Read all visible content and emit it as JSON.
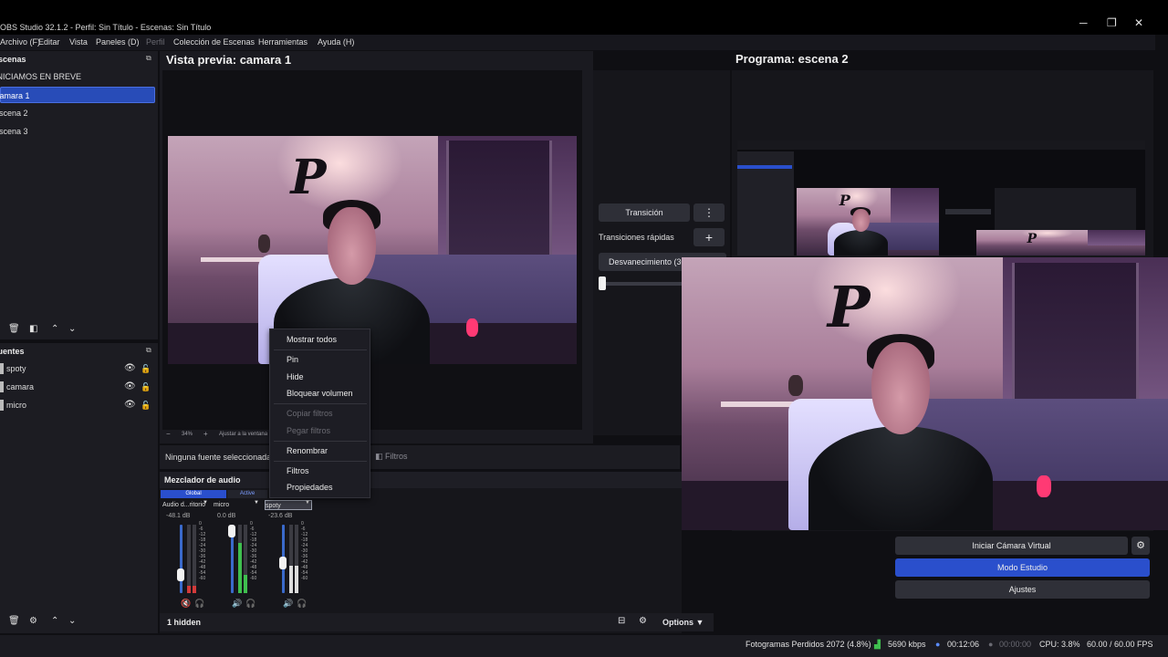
{
  "window": {
    "title": "OBS Studio 32.1.2 - Perfil: Sin Título - Escenas: Sin Título",
    "minimize": "─",
    "restore": "❐",
    "close": "✕"
  },
  "menu": {
    "items": [
      "Archivo (F)",
      "Editar",
      "Vista",
      "Paneles (D)",
      "Perfil",
      "Colección de Escenas",
      "Herramientas",
      "Ayuda (H)"
    ]
  },
  "scenes": {
    "title": "Escenas",
    "items": [
      "INICIAMOS EN BREVE",
      "camara 1",
      "escena 2",
      "escena 3"
    ],
    "selected": "camara 1"
  },
  "sources": {
    "title": "Fuentes",
    "items": [
      {
        "label": "spoty"
      },
      {
        "label": "camara"
      },
      {
        "label": "micro"
      }
    ]
  },
  "preview": {
    "title": "Vista previa: camara 1",
    "zoom": "34%",
    "zoom_minus": "−",
    "zoom_plus": "+",
    "fit": "Ajustar a la ventana"
  },
  "program": {
    "title": "Programa: escena 2"
  },
  "transitions": {
    "transition_button": "Transición",
    "quick_label": "Transiciones rápidas",
    "fade_label": "Desvanecimiento (30"
  },
  "source_bar": {
    "no_source": "Ninguna fuente seleccionada",
    "filters": "Filtros"
  },
  "mixer": {
    "title": "Mezclador de audio",
    "tab_global": "Global",
    "tab_active": "Active",
    "channels": [
      {
        "name": "Audio d...ritorio",
        "db": "-48.1 dB",
        "level": 0.2,
        "muted": true
      },
      {
        "name": "micro",
        "db": "0.0 dB",
        "level": 0.95,
        "muted": false
      },
      {
        "name": "spoty",
        "db": "-23.6 dB",
        "level": 0.55,
        "muted": false
      }
    ],
    "ticks": [
      "0",
      "-6",
      "-12",
      "-18",
      "-24",
      "-30",
      "-36",
      "-42",
      "-48",
      "-54",
      "-60"
    ],
    "hidden_label": "1 hidden",
    "options": "Options"
  },
  "controls": {
    "virtual_cam": "Iniciar Cámara Virtual",
    "studio_mode": "Modo Estudio",
    "settings": "Ajustes"
  },
  "context_menu": {
    "items": [
      {
        "label": "Mostrar todos",
        "enabled": true
      },
      {
        "label": "Pin",
        "enabled": true
      },
      {
        "label": "Hide",
        "enabled": true
      },
      {
        "label": "Bloquear volumen",
        "enabled": true
      },
      {
        "label": "Copiar filtros",
        "enabled": false
      },
      {
        "label": "Pegar filtros",
        "enabled": false
      },
      {
        "label": "Renombrar",
        "enabled": true
      },
      {
        "label": "Filtros",
        "enabled": true
      },
      {
        "label": "Propiedades",
        "enabled": true
      }
    ]
  },
  "status": {
    "dropped_frames": "Fotogramas Perdidos 2072 (4.8%)",
    "bitrate": "5690 kbps",
    "stream_time": "00:12:06",
    "rec_time": "00:00:00",
    "cpu": "CPU: 3.8%",
    "fps": "60.00 / 60.00 FPS"
  },
  "colors": {
    "accent": "#2a4fcc",
    "selection": "#284cb8",
    "background": "#0f0f13",
    "panel": "#1c1c22",
    "meter_green": "#3fbf4f",
    "meter_red": "#d23a3a",
    "live_green": "#3fbf4f"
  },
  "icons": {
    "eye": "eye-icon",
    "lock": "lock-icon",
    "gear": "gear-icon",
    "trash": "trash-icon",
    "speaker": "speaker-icon",
    "headphones": "headphones-icon",
    "kebab": "kebab-icon",
    "plus": "plus-icon"
  }
}
